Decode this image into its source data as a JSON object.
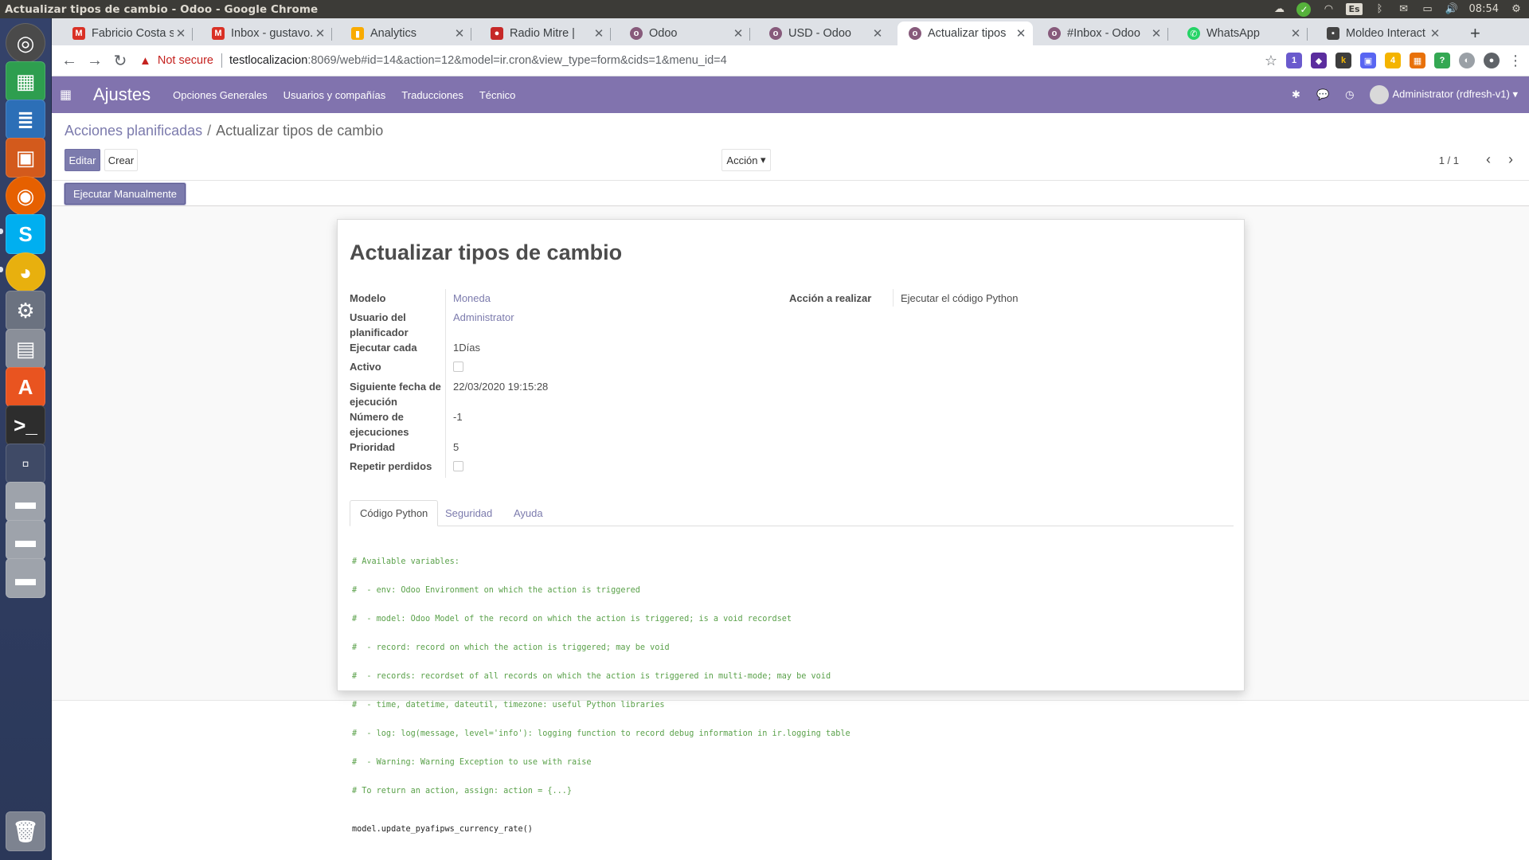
{
  "os": {
    "window_title": "Actualizar tipos de cambio - Odoo - Google Chrome",
    "keyboard_layout": "Es",
    "clock": "08:54"
  },
  "browser": {
    "tabs": [
      {
        "label": "Fabricio Costa s",
        "icon": "gmail-icon",
        "color": "#d93025"
      },
      {
        "label": "Inbox - gustavo.",
        "icon": "gmail-icon",
        "color": "#d93025"
      },
      {
        "label": "Analytics",
        "icon": "analytics-icon",
        "color": "#f9ab00"
      },
      {
        "label": "Radio Mitre |",
        "icon": "radio-icon",
        "color": "#c62828"
      },
      {
        "label": "Odoo",
        "icon": "odoo-icon",
        "color": "#875a7b"
      },
      {
        "label": "USD - Odoo",
        "icon": "odoo-icon",
        "color": "#875a7b"
      },
      {
        "label": "Actualizar tipos",
        "icon": "odoo-icon",
        "color": "#875a7b"
      },
      {
        "label": "#Inbox - Odoo",
        "icon": "odoo-icon",
        "color": "#875a7b"
      },
      {
        "label": "WhatsApp",
        "icon": "whatsapp-icon",
        "color": "#25d366"
      },
      {
        "label": "Moldeo Interact",
        "icon": "site-icon",
        "color": "#444444"
      }
    ],
    "not_secure_label": "Not secure",
    "url_host": "testlocalizacion",
    "url_path": ":8069/web#id=14&action=12&model=ir.cron&view_type=form&cids=1&menu_id=4"
  },
  "odoo": {
    "app_name": "Ajustes",
    "menu": [
      "Opciones Generales",
      "Usuarios y compañías",
      "Traducciones",
      "Técnico"
    ],
    "user": "Administrator (rdfresh-v1)",
    "breadcrumb_parent": "Acciones planificadas",
    "breadcrumb_current": "Actualizar tipos de cambio",
    "edit_label": "Editar",
    "create_label": "Crear",
    "action_label": "Acción",
    "pager": "1 / 1",
    "run_label": "Ejecutar Manualmente",
    "record_title": "Actualizar tipos de cambio",
    "fields": {
      "modelo_label": "Modelo",
      "modelo_value": "Moneda",
      "usuario_label_1": "Usuario del",
      "usuario_label_2": "planificador",
      "usuario_value": "Administrator",
      "ejecutar_label": "Ejecutar cada",
      "ejecutar_value": "1Días",
      "activo_label": "Activo",
      "activo_checked": false,
      "siguiente_label_1": "Siguiente fecha de",
      "siguiente_label_2": "ejecución",
      "siguiente_value": "22/03/2020 19:15:28",
      "numero_label_1": "Número de",
      "numero_label_2": "ejecuciones",
      "numero_value": "-1",
      "prioridad_label": "Prioridad",
      "prioridad_value": "5",
      "repetir_label": "Repetir perdidos",
      "repetir_checked": false,
      "accion_label": "Acción a realizar",
      "accion_value": "Ejecutar el código Python"
    },
    "tabs": [
      "Código Python",
      "Seguridad",
      "Ayuda"
    ],
    "code_comments": [
      "# Available variables:",
      "#  - env: Odoo Environment on which the action is triggered",
      "#  - model: Odoo Model of the record on which the action is triggered; is a void recordset",
      "#  - record: record on which the action is triggered; may be void",
      "#  - records: recordset of all records on which the action is triggered in multi-mode; may be void",
      "#  - time, datetime, dateutil, timezone: useful Python libraries",
      "#  - log: log(message, level='info'): logging function to record debug information in ir.logging table",
      "#  - Warning: Warning Exception to use with raise",
      "# To return an action, assign: action = {...}"
    ],
    "code_statement": "model.update_pyafipws_currency_rate()",
    "accent_color": "#7c7bad"
  }
}
